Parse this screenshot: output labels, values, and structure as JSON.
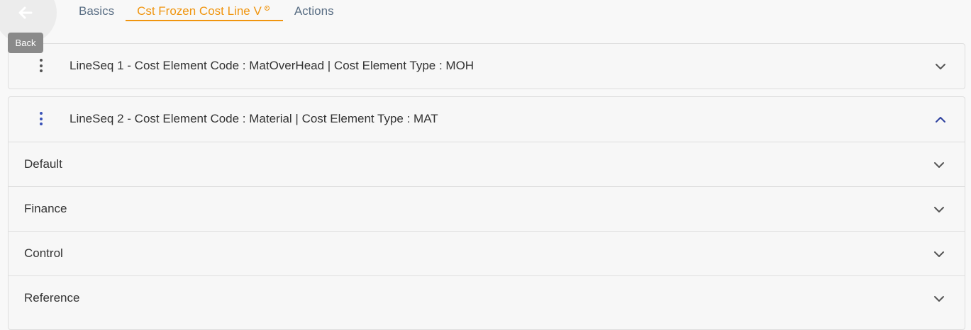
{
  "back": {
    "tooltip": "Back",
    "icon": "arrow-left-icon"
  },
  "tabs": [
    {
      "label": "Basics",
      "active": false
    },
    {
      "label": "Cst Frozen Cost Line V",
      "active": true
    },
    {
      "label": "Actions",
      "active": false
    }
  ],
  "lines": [
    {
      "title": "LineSeq 1 - Cost Element Code  : MatOverHead | Cost Element Type  : MOH",
      "expanded": false
    },
    {
      "title": "LineSeq 2 - Cost Element Code  : Material | Cost Element Type  : MAT",
      "expanded": true
    }
  ],
  "sections": [
    {
      "label": "Default"
    },
    {
      "label": "Finance"
    },
    {
      "label": "Control"
    },
    {
      "label": "Reference"
    }
  ],
  "colors": {
    "accent": "#f0950f",
    "tab_text": "#5b6f85",
    "kebab_active": "#3a52b8",
    "chevron_active": "#2c3f9e"
  }
}
